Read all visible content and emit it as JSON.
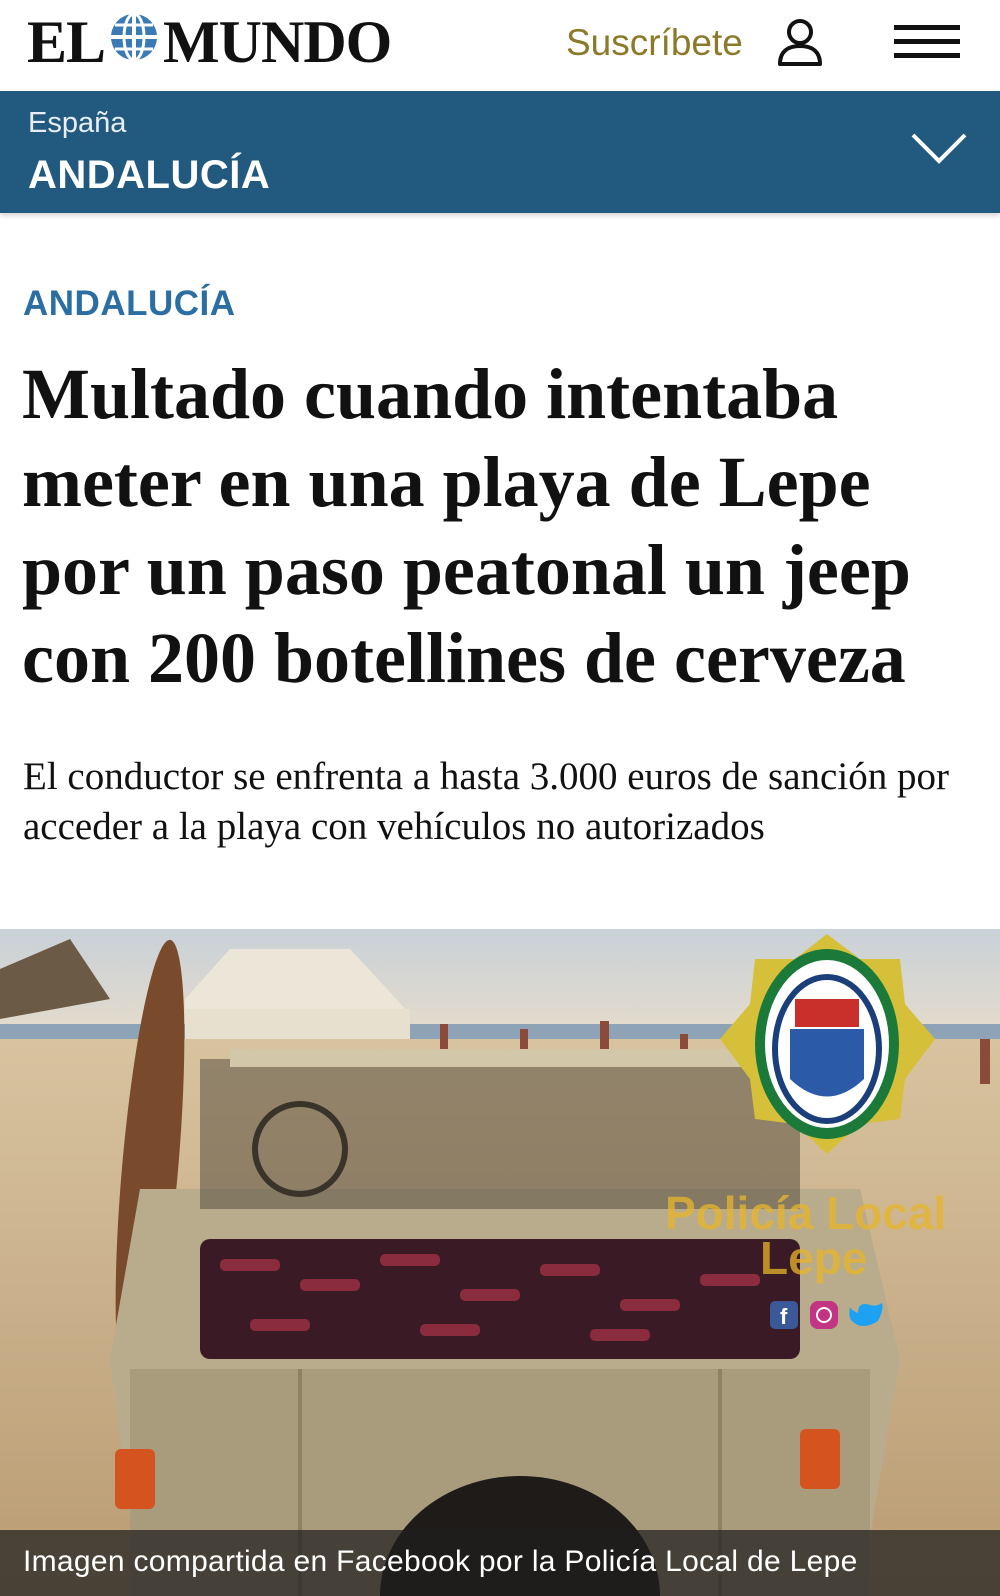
{
  "header": {
    "logo_left": "EL",
    "logo_right": "MUNDO",
    "subscribe_label": "Suscríbete"
  },
  "section": {
    "parent": "España",
    "name": "ANDALUCÍA"
  },
  "article": {
    "kicker": "ANDALUCÍA",
    "headline": "Multado cuando intentaba meter en una playa de Lepe por un paso peatonal un jeep con 200 botellines de cerveza",
    "standfirst": "El conductor se enfrenta a hasta 3.000 euros de sanción por acceder a la playa con vehículos no autorizados"
  },
  "photo": {
    "caption": "Imagen compartida en Facebook por la Policía Local de Lepe",
    "watermark_line1": "Policía Local",
    "watermark_line2": "Lepe"
  },
  "colors": {
    "section_bar": "#22597f",
    "kicker": "#2b6ea3",
    "subscribe": "#8a7a2a"
  },
  "icons": [
    "globe-icon",
    "user-icon",
    "hamburger-menu-icon",
    "chevron-down-icon",
    "facebook-icon",
    "instagram-icon",
    "twitter-icon",
    "police-badge-icon"
  ]
}
